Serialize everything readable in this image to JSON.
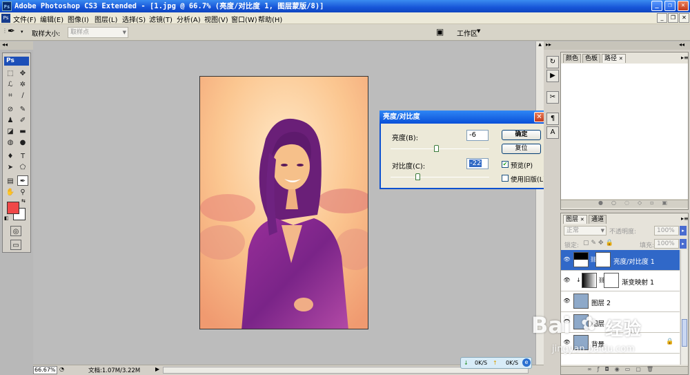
{
  "window": {
    "title": "Adobe Photoshop CS3 Extended - [1.jpg @ 66.7% (亮度/对比度 1, 图层蒙版/8)]",
    "app_badge": "Ps"
  },
  "menu": [
    "文件(F)",
    "编辑(E)",
    "图像(I)",
    "图层(L)",
    "选择(S)",
    "滤镜(T)",
    "分析(A)",
    "视图(V)",
    "窗口(W)",
    "帮助(H)"
  ],
  "options_bar": {
    "sample_size_label": "取样大小:",
    "sample_size_value": "取样点",
    "workspace_label": "工作区"
  },
  "toolbox": {
    "label": "Ps"
  },
  "brightness_contrast_dialog": {
    "title": "亮度/对比度",
    "brightness_label": "亮度(B):",
    "brightness_value": "-6",
    "brightness_level": 0.47,
    "contrast_label": "对比度(C):",
    "contrast_value": "-22",
    "contrast_level": 0.28,
    "ok_label": "确定",
    "reset_label": "复位",
    "preview_label": "预览(P)",
    "preview_checked": true,
    "use_legacy_label": "使用旧版(L)",
    "use_legacy_checked": false
  },
  "top_panel": {
    "tabs": [
      "颜色",
      "色板",
      "路径"
    ],
    "active_tab": "路径"
  },
  "layers_panel": {
    "tabs": [
      "图层",
      "通道"
    ],
    "blend_mode": "正常",
    "opacity_label": "不透明度:",
    "opacity_value": "100%",
    "lock_label": "锁定:",
    "fill_label": "填充:",
    "fill_value": "100%",
    "layers": [
      {
        "name": "亮度/对比度 1",
        "selected": true
      },
      {
        "name": "渐变映射 1",
        "selected": false
      },
      {
        "name": "图层 2",
        "selected": false
      },
      {
        "name": "图层",
        "selected": false
      },
      {
        "name": "背景",
        "selected": false
      }
    ]
  },
  "status_bar": {
    "zoom": "66.67%",
    "doc_info": "文档:1.07M/3.22M"
  },
  "network_widget": {
    "down": "0K/S",
    "up": "0K/S"
  },
  "watermark": {
    "brand": "Bai",
    "brand_cn": "经验",
    "url": "jingyan.baidu.com"
  },
  "colors": {
    "foreground": "#f04848",
    "background": "#ffffff",
    "titlebar": "#1755d8",
    "selection": "#3068c8"
  }
}
